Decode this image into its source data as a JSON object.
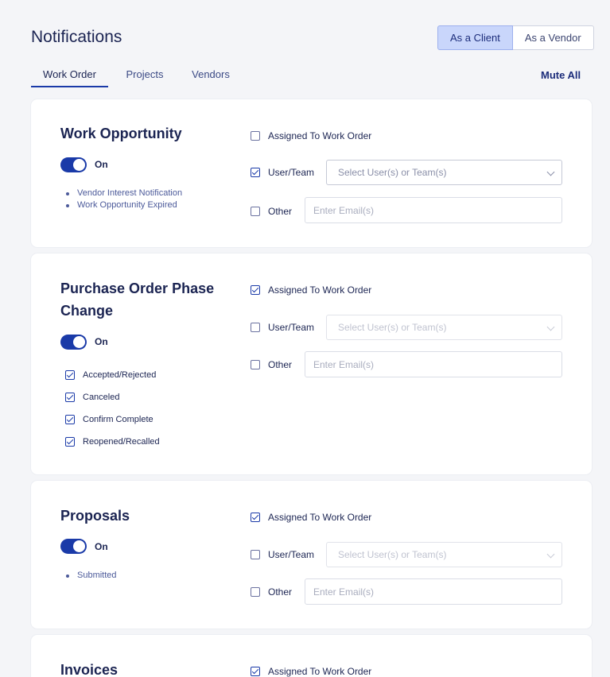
{
  "page": {
    "title": "Notifications"
  },
  "role_toggle": {
    "client": "As a Client",
    "vendor": "As a Vendor",
    "selected": "As a Client"
  },
  "tabs": [
    "Work Order",
    "Projects",
    "Vendors"
  ],
  "active_tab": "Work Order",
  "mute_all": "Mute All",
  "cards": [
    {
      "title": "Work Opportunity",
      "toggle": "On",
      "sub_items": [
        "Vendor Interest Notification",
        "Work Opportunity Expired"
      ],
      "assigned_label": "Assigned To Work Order",
      "assigned_checked": false,
      "user_team_label": "User/Team",
      "user_team_checked": true,
      "select_placeholder": "Select User(s) or Team(s)",
      "other_label": "Other",
      "other_checked": false,
      "email_placeholder": "Enter Email(s)"
    },
    {
      "title_line1": "Purchase Order Phase",
      "title_line2": "Change",
      "toggle": "On",
      "sub_checks": [
        "Accepted/Rejected",
        "Canceled",
        "Confirm Complete",
        "Reopened/Recalled"
      ],
      "assigned_label": "Assigned To Work Order",
      "assigned_checked": true,
      "user_team_label": "User/Team",
      "user_team_checked": false,
      "select_placeholder": "Select User(s) or Team(s)",
      "other_label": "Other",
      "other_checked": false,
      "email_placeholder": "Enter Email(s)"
    },
    {
      "title": "Proposals",
      "toggle": "On",
      "sub_items": [
        "Submitted"
      ],
      "assigned_label": "Assigned To Work Order",
      "assigned_checked": true,
      "user_team_label": "User/Team",
      "user_team_checked": false,
      "select_placeholder": "Select User(s) or Team(s)",
      "other_label": "Other",
      "other_checked": false,
      "email_placeholder": "Enter Email(s)"
    },
    {
      "title": "Invoices",
      "assigned_label": "Assigned To Work Order",
      "assigned_checked": true
    }
  ],
  "colors": {
    "accent": "#1a3aa8",
    "selected_role_bg": "#c9d6fb",
    "page_bg": "#f4f5f8"
  }
}
